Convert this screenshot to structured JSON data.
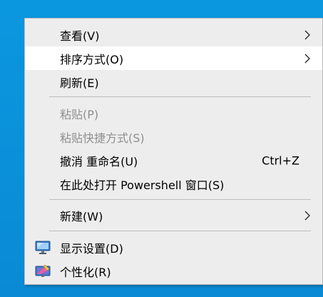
{
  "context_menu": {
    "items": [
      {
        "label": "查看(V)",
        "has_submenu": true
      },
      {
        "label": "排序方式(O)",
        "has_submenu": true,
        "highlighted": true
      },
      {
        "label": "刷新(E)"
      },
      {
        "label": "粘贴(P)",
        "disabled": true
      },
      {
        "label": "粘贴快捷方式(S)",
        "disabled": true
      },
      {
        "label": "撤消 重命名(U)",
        "shortcut": "Ctrl+Z"
      },
      {
        "label": "在此处打开 Powershell 窗口(S)"
      },
      {
        "label": "新建(W)",
        "has_submenu": true
      },
      {
        "label": "显示设置(D)",
        "icon": "display-settings-icon"
      },
      {
        "label": "个性化(R)",
        "icon": "personalize-icon"
      }
    ]
  },
  "colors": {
    "desktop_blue": "#0a8fd8",
    "menu_bg": "#ededed",
    "hover_bg": "#ffffff",
    "disabled_text": "#8f8f8f",
    "separator": "#bdbdbd"
  }
}
